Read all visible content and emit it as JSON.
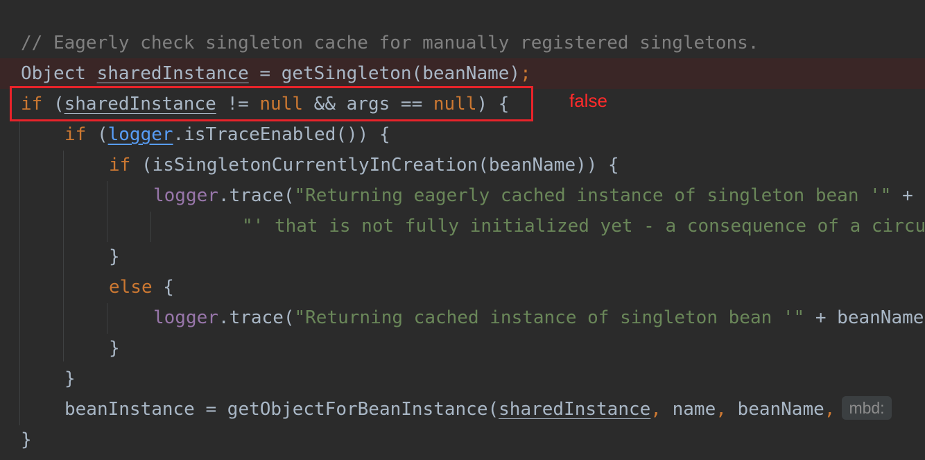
{
  "editor": {
    "line1": {
      "comment": "// Eagerly check singleton cache for manually registered singletons."
    },
    "line2": {
      "type": "Object",
      "var": "sharedInstance",
      "eq": " = ",
      "call": "getSingleton(beanName)",
      "semi": ";"
    },
    "line3": {
      "kw_if": "if",
      "open": " (",
      "var": "sharedInstance",
      "op1": " != ",
      "null1": "null",
      "op2": " && args == ",
      "null2": "null",
      "close": ") {"
    },
    "line4": {
      "kw_if": "if",
      "open": " (",
      "logger": "logger",
      "rest": ".isTraceEnabled()) {"
    },
    "line5": {
      "kw_if": "if",
      "rest": " (isSingletonCurrentlyInCreation(beanName)) {"
    },
    "line6": {
      "logger": "logger",
      "call": ".trace(",
      "str": "\"Returning eagerly cached instance of singleton bean '\"",
      "tail": " +"
    },
    "line7": {
      "str": "\"' that is not fully initialized yet - a consequence of a circular reference\");"
    },
    "line8": {
      "brace": "}"
    },
    "line9": {
      "kw_else": "else",
      "brace": " {"
    },
    "line10": {
      "logger": "logger",
      "call": ".trace(",
      "str": "\"Returning cached instance of singleton bean '\"",
      "tail": " + beanName + \"'\");"
    },
    "line11": {
      "brace": "}"
    },
    "line12": {
      "brace": "}"
    },
    "line13": {
      "assign": "beanInstance = getObjectForBeanInstance(",
      "var": "sharedInstance",
      "comma1": ",",
      "name": " name",
      "comma2": ",",
      "bean": " beanName",
      "comma3": ",",
      "hint": "mbd:"
    },
    "line14": {
      "brace": "}"
    }
  },
  "annotation": {
    "text": "false",
    "color": "#ff2b2b"
  },
  "colors": {
    "background": "#2b2b2b",
    "keyword": "#cc7832",
    "string": "#6a8759",
    "field": "#9876aa",
    "comment": "#808080",
    "default": "#a9b7c6",
    "highlight_box": "#e8232a"
  }
}
